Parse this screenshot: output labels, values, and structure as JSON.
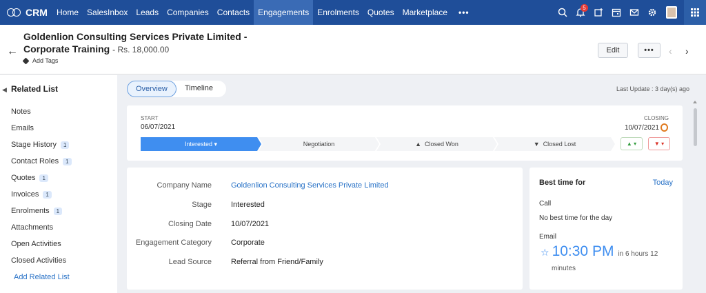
{
  "app": {
    "brand": "CRM"
  },
  "nav": {
    "items": [
      "Home",
      "SalesInbox",
      "Leads",
      "Companies",
      "Contacts",
      "Engagements",
      "Enrolments",
      "Quotes",
      "Marketplace"
    ],
    "more": "•••",
    "notification_count": "5"
  },
  "record": {
    "title_line1": "Goldenlion Consulting Services Private Limited -",
    "title_line2": "Corporate Training",
    "amount": "- Rs. 18,000.00",
    "add_tags": "Add Tags",
    "edit_label": "Edit",
    "more_label": "•••"
  },
  "sidebar": {
    "title": "Related List",
    "items": [
      {
        "label": "Notes",
        "count": ""
      },
      {
        "label": "Emails",
        "count": ""
      },
      {
        "label": "Stage History",
        "count": "1"
      },
      {
        "label": "Contact Roles",
        "count": "1"
      },
      {
        "label": "Quotes",
        "count": "1"
      },
      {
        "label": "Invoices",
        "count": "1"
      },
      {
        "label": "Enrolments",
        "count": "1"
      },
      {
        "label": "Attachments",
        "count": ""
      },
      {
        "label": "Open Activities",
        "count": ""
      },
      {
        "label": "Closed Activities",
        "count": ""
      }
    ],
    "add_link": "Add Related List"
  },
  "tabs": [
    "Overview",
    "Timeline"
  ],
  "last_update": "Last Update : 3 day(s) ago",
  "stage_card": {
    "start_label": "START",
    "start_date": "06/07/2021",
    "closing_label": "CLOSING",
    "closing_date": "10/07/2021",
    "stages": [
      "Interested ▾",
      "Negotiation",
      "Closed Won",
      "Closed Lost"
    ]
  },
  "details": {
    "fields": [
      {
        "label": "Company Name",
        "value": "Goldenlion Consulting Services Private Limited"
      },
      {
        "label": "Stage",
        "value": "Interested"
      },
      {
        "label": "Closing Date",
        "value": "10/07/2021"
      },
      {
        "label": "Engagement Category",
        "value": "Corporate"
      },
      {
        "label": "Lead Source",
        "value": "Referral from Friend/Family"
      }
    ]
  },
  "best_time": {
    "title": "Best time for",
    "today": "Today",
    "call_label": "Call",
    "call_text": "No best time for the day",
    "email_label": "Email",
    "email_time": "10:30 PM",
    "email_in": "in 6 hours 12",
    "email_minutes": "minutes"
  },
  "colors": {
    "nav_bg": "#1f4e99",
    "accent": "#3f8ef0",
    "link": "#2a73c7"
  }
}
